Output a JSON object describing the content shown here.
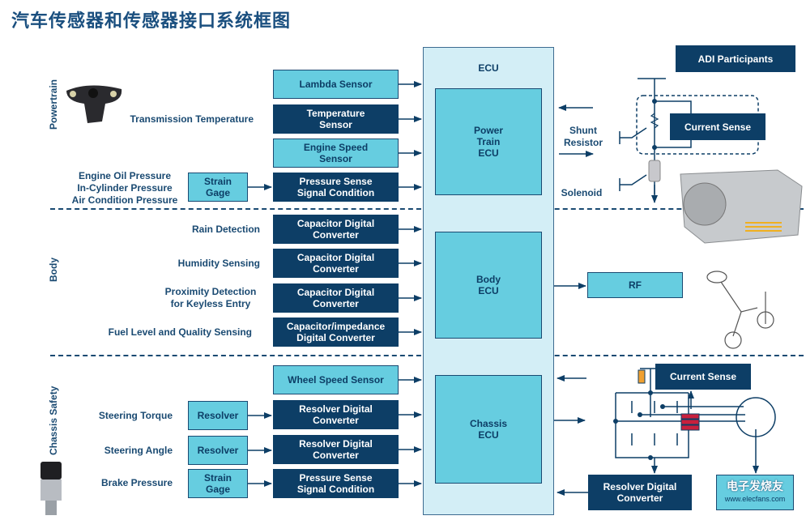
{
  "title": "汽车传感器和传感器接口系统框图",
  "adi_participants": "ADI Participants",
  "colors": {
    "dark_box": "#0d3e66",
    "light_box": "#66cde0",
    "ecu_bg": "#d3eef6",
    "accent_red": "#c8203c",
    "accent_orange": "#f0a030"
  },
  "ecu": {
    "label": "ECU",
    "powertrain_ecu": "Power\nTrain\nECU",
    "body_ecu": "Body\nECU",
    "chassis_ecu": "Chassis\nECU"
  },
  "sections": {
    "powertrain": "Powertrain",
    "body": "Body",
    "chassis": "Chassis Safety"
  },
  "powertrain": {
    "lambda": "Lambda Sensor",
    "temp_label": "Transmission Temperature",
    "temp_sensor": "Temperature\nSensor",
    "engine_speed": "Engine Speed\nSensor",
    "pressure_labels": "Engine Oil Pressure\nIn-Cylinder Pressure\nAir Condition Pressure",
    "strain_gage": "Strain\nGage",
    "pressure_sense": "Pressure Sense\nSignal Condition",
    "shunt_resistor": "Shunt\nResistor",
    "current_sense": "Current Sense",
    "solenoid": "Solenoid"
  },
  "body": {
    "rows": [
      {
        "label": "Rain Detection",
        "box": "Capacitor Digital\nConverter"
      },
      {
        "label": "Humidity Sensing",
        "box": "Capacitor Digital\nConverter"
      },
      {
        "label": "Proximity Detection\nfor Keyless Entry",
        "box": "Capacitor Digital\nConverter"
      },
      {
        "label": "Fuel Level and Quality Sensing",
        "box": "Capacitor/impedance\nDigital Converter"
      }
    ],
    "rf": "RF"
  },
  "chassis": {
    "wheel_speed": "Wheel Speed Sensor",
    "rows": [
      {
        "label": "Steering Torque",
        "sensor": "Resolver",
        "box": "Resolver Digital\nConverter"
      },
      {
        "label": "Steering Angle",
        "sensor": "Resolver",
        "box": "Resolver Digital\nConverter"
      },
      {
        "label": "Brake Pressure",
        "sensor": "Strain\nGage",
        "box": "Pressure Sense\nSignal Condition"
      }
    ],
    "current_sense": "Current Sense",
    "resolver_out": "Resolver Digital\nConverter",
    "watermark": "电子发烧友",
    "watermark_url": "www.elecfans.com"
  }
}
